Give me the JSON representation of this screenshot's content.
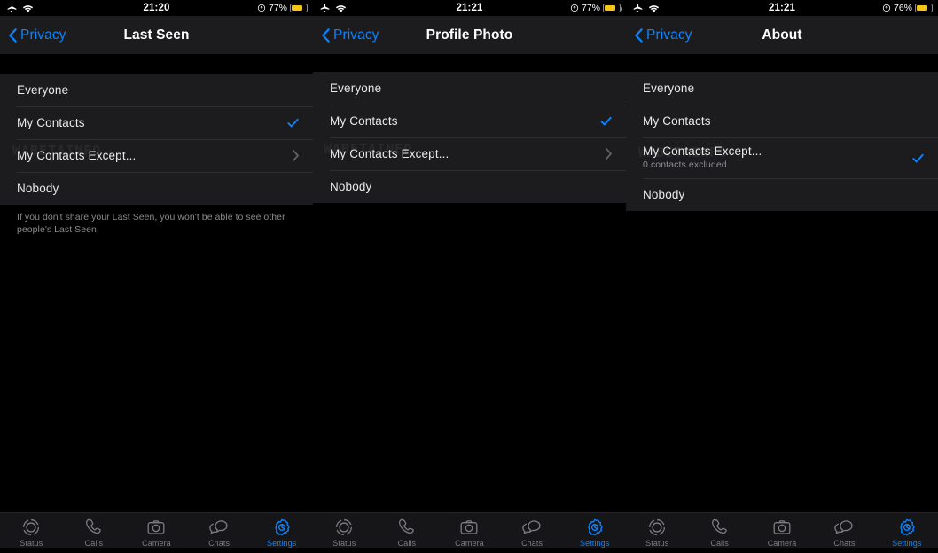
{
  "accent": "#0a84ff",
  "battery_color": "#f5c518",
  "watermark": "WABETAINFO",
  "panels": [
    {
      "statusbar": {
        "time": "21:20",
        "battery_pct": "77%",
        "airplane_icon": "airplane-icon",
        "wifi_icon": "wifi-icon",
        "lowpower_icon": "low-power-icon"
      },
      "nav": {
        "back_label": "Privacy",
        "title": "Last Seen"
      },
      "rows": [
        {
          "title": "Everyone",
          "sub": "",
          "accessory": "none"
        },
        {
          "title": "My Contacts",
          "sub": "",
          "accessory": "check"
        },
        {
          "title": "My Contacts Except...",
          "sub": "",
          "accessory": "chevron"
        },
        {
          "title": "Nobody",
          "sub": "",
          "accessory": "none"
        }
      ],
      "footer": "If you don't share your Last Seen, you won't be able to see other people's Last Seen."
    },
    {
      "statusbar": {
        "time": "21:21",
        "battery_pct": "77%",
        "airplane_icon": "airplane-icon",
        "wifi_icon": "wifi-icon",
        "lowpower_icon": "low-power-icon"
      },
      "nav": {
        "back_label": "Privacy",
        "title": "Profile Photo"
      },
      "rows": [
        {
          "title": "Everyone",
          "sub": "",
          "accessory": "none"
        },
        {
          "title": "My Contacts",
          "sub": "",
          "accessory": "check"
        },
        {
          "title": "My Contacts Except...",
          "sub": "",
          "accessory": "chevron"
        },
        {
          "title": "Nobody",
          "sub": "",
          "accessory": "none"
        }
      ],
      "footer": ""
    },
    {
      "statusbar": {
        "time": "21:21",
        "battery_pct": "76%",
        "airplane_icon": "airplane-icon",
        "wifi_icon": "wifi-icon",
        "lowpower_icon": "low-power-icon"
      },
      "nav": {
        "back_label": "Privacy",
        "title": "About"
      },
      "rows": [
        {
          "title": "Everyone",
          "sub": "",
          "accessory": "none"
        },
        {
          "title": "My Contacts",
          "sub": "",
          "accessory": "none"
        },
        {
          "title": "My Contacts Except...",
          "sub": "0 contacts excluded",
          "accessory": "check"
        },
        {
          "title": "Nobody",
          "sub": "",
          "accessory": "none"
        }
      ],
      "footer": ""
    }
  ],
  "tabbar": {
    "items": [
      {
        "label": "Status",
        "icon": "status-icon",
        "active": false
      },
      {
        "label": "Calls",
        "icon": "phone-icon",
        "active": false
      },
      {
        "label": "Camera",
        "icon": "camera-icon",
        "active": false
      },
      {
        "label": "Chats",
        "icon": "chats-icon",
        "active": false
      },
      {
        "label": "Settings",
        "icon": "gear-icon",
        "active": true
      }
    ]
  }
}
